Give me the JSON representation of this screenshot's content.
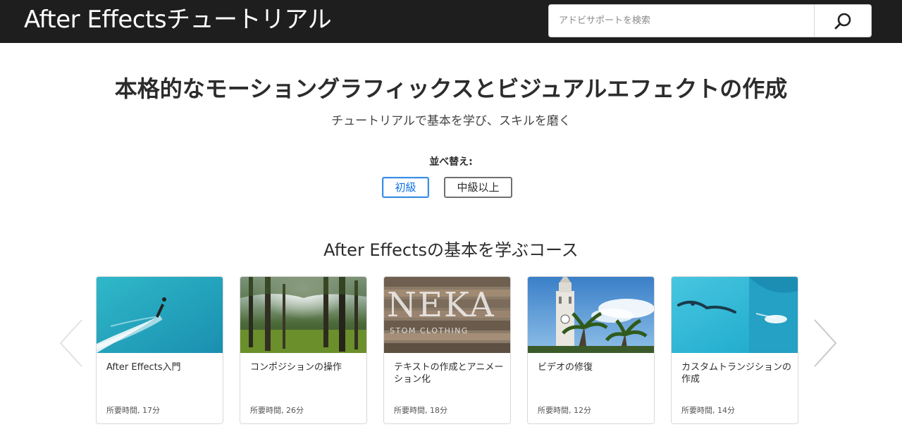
{
  "header": {
    "app_title": "After Effectsチュートリアル",
    "search_placeholder": "アドビサポートを検索",
    "search_icon": "search-icon"
  },
  "hero": {
    "title": "本格的なモーショングラフィックスとビジュアルエフェクトの作成",
    "subtitle": "チュートリアルで基本を学び、スキルを磨く"
  },
  "sort": {
    "label": "並べ替え:",
    "options": [
      "初級",
      "中級以上"
    ],
    "selected": "初級"
  },
  "section": {
    "title": "After Effectsの基本を学ぶコース"
  },
  "carousel": {
    "prev_icon": "chevron-left-icon",
    "next_icon": "chevron-right-icon",
    "cards": [
      {
        "title": "After Effects入門",
        "duration": "所要時間, 17分"
      },
      {
        "title": "コンポジションの操作",
        "duration": "所要時間, 26分"
      },
      {
        "title": "テキストの作成とアニメーション化",
        "duration": "所要時間, 18分"
      },
      {
        "title": "ビデオの修復",
        "duration": "所要時間, 12分"
      },
      {
        "title": "カスタムトランジションの作成",
        "duration": "所要時間, 14分"
      }
    ],
    "thumb_sign_text": "NEKA",
    "thumb_sign_subtext": "STOM CLOTHING"
  },
  "colors": {
    "header_bg": "#1e1e1e",
    "accent": "#1473e6"
  }
}
